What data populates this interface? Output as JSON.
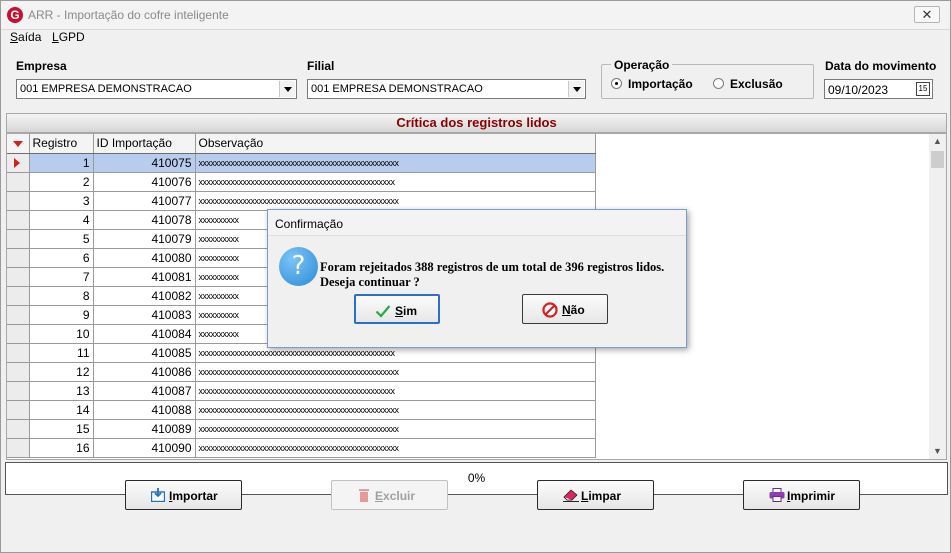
{
  "window": {
    "title": "ARR - Importação do cofre inteligente",
    "close_glyph": "✕"
  },
  "menu": [
    {
      "mnemonic": "S",
      "rest": "aída"
    },
    {
      "mnemonic": "L",
      "rest": "GPD"
    }
  ],
  "form": {
    "empresa_label": "Empresa",
    "empresa_value": "001 EMPRESA DEMONSTRACAO",
    "filial_label": "Filial",
    "filial_value": "001 EMPRESA DEMONSTRACAO",
    "operacao_label": "Operação",
    "opt_importacao": "Importação",
    "opt_exclusao": "Exclusão",
    "selected_operation": "Importação",
    "data_label": "Data do movimento",
    "data_value": "09/10/2023",
    "calendar_glyph": "15"
  },
  "grid": {
    "title": "Crítica dos registros lidos",
    "columns": [
      "Registro",
      "ID Importação",
      "Observação"
    ],
    "rows": [
      {
        "registro": "1",
        "id": "410075",
        "obs": "xxxxxxxxxxxxxxxxxxxxxxxxxxxxxxxxxxxxxxxxxxxxxxxxxx"
      },
      {
        "registro": "2",
        "id": "410076",
        "obs": "xxxxxxxxxxxxxxxxxxxxxxxxxxxxxxxxxxxxxxxxxxxxxxxxx"
      },
      {
        "registro": "3",
        "id": "410077",
        "obs": "xxxxxxxxxxxxxxxxxxxxxxxxxxxxxxxxxxxxxxxxxxxxxxxxxx"
      },
      {
        "registro": "4",
        "id": "410078",
        "obs": "xxxxxxxxxx"
      },
      {
        "registro": "5",
        "id": "410079",
        "obs": "xxxxxxxxxx"
      },
      {
        "registro": "6",
        "id": "410080",
        "obs": "xxxxxxxxxx"
      },
      {
        "registro": "7",
        "id": "410081",
        "obs": "xxxxxxxxxx"
      },
      {
        "registro": "8",
        "id": "410082",
        "obs": "xxxxxxxxxx"
      },
      {
        "registro": "9",
        "id": "410083",
        "obs": "xxxxxxxxxx"
      },
      {
        "registro": "10",
        "id": "410084",
        "obs": "xxxxxxxxxx"
      },
      {
        "registro": "11",
        "id": "410085",
        "obs": "xxxxxxxxxxxxxxxxxxxxxxxxxxxxxxxxxxxxxxxxxxxxxxxxx"
      },
      {
        "registro": "12",
        "id": "410086",
        "obs": "xxxxxxxxxxxxxxxxxxxxxxxxxxxxxxxxxxxxxxxxxxxxxxxxxx"
      },
      {
        "registro": "13",
        "id": "410087",
        "obs": "xxxxxxxxxxxxxxxxxxxxxxxxxxxxxxxxxxxxxxxxxxxxxxxxx"
      },
      {
        "registro": "14",
        "id": "410088",
        "obs": "xxxxxxxxxxxxxxxxxxxxxxxxxxxxxxxxxxxxxxxxxxxxxxxxxx"
      },
      {
        "registro": "15",
        "id": "410089",
        "obs": "xxxxxxxxxxxxxxxxxxxxxxxxxxxxxxxxxxxxxxxxxxxxxxxxxx"
      },
      {
        "registro": "16",
        "id": "410090",
        "obs": "xxxxxxxxxxxxxxxxxxxxxxxxxxxxxxxxxxxxxxxxxxxxxxxxxx"
      }
    ]
  },
  "progress": {
    "text": "0%",
    "value": 0
  },
  "buttons": {
    "importar": {
      "mnemonic": "I",
      "rest": "mportar"
    },
    "excluir": {
      "mnemonic": "E",
      "rest": "xcluir"
    },
    "limpar": {
      "mnemonic": "L",
      "rest": "impar"
    },
    "imprimir": {
      "mnemonic": "I",
      "rest": "mprimir"
    }
  },
  "dialog": {
    "title": "Confirmação",
    "line1": "Foram rejeitados 388 registros de um total de 396 registros lidos.",
    "line2": "Deseja continuar ?",
    "icon_glyph": "?",
    "sim": {
      "mnemonic": "S",
      "rest": "im"
    },
    "nao": {
      "mnemonic": "N",
      "rest": "ão"
    }
  },
  "colors": {
    "header_text": "#8b0000",
    "selected_row": "#b8cdee",
    "accent_red": "#d21f1f",
    "dialog_border": "#7b9ccc"
  }
}
